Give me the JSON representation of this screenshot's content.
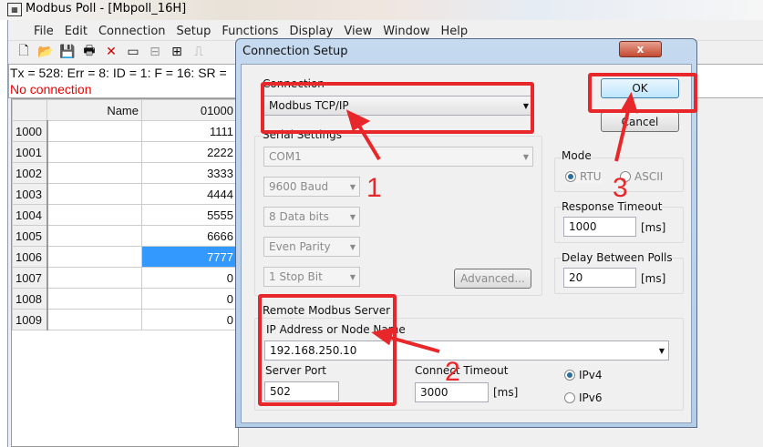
{
  "app": {
    "title": "Modbus Poll - [Mbpoll_16H]",
    "icon": "modbus-app-icon"
  },
  "menu": [
    "File",
    "Edit",
    "Connection",
    "Setup",
    "Functions",
    "Display",
    "View",
    "Window",
    "Help"
  ],
  "toolbar": [
    {
      "icon": "new-icon",
      "glyph": "🗋"
    },
    {
      "icon": "open-icon",
      "glyph": "📂"
    },
    {
      "icon": "save-icon",
      "glyph": "💾"
    },
    {
      "icon": "print-icon",
      "glyph": "🖶"
    },
    {
      "icon": "delete-icon",
      "glyph": "✕"
    },
    {
      "icon": "window-icon",
      "glyph": "▭"
    },
    {
      "icon": "poll-icon",
      "glyph": "⊟"
    },
    {
      "icon": "device-icon",
      "glyph": "⊞"
    },
    {
      "icon": "pulse-icon",
      "glyph": "⎍"
    }
  ],
  "status": {
    "line": "Tx = 528: Err = 8: ID = 1: F = 16: SR =",
    "connection": "No connection"
  },
  "grid": {
    "headers": [
      "",
      "Name",
      "01000"
    ],
    "rows": [
      [
        "1000",
        "",
        "1111"
      ],
      [
        "1001",
        "",
        "2222"
      ],
      [
        "1002",
        "",
        "3333"
      ],
      [
        "1003",
        "",
        "4444"
      ],
      [
        "1004",
        "",
        "5555"
      ],
      [
        "1005",
        "",
        "6666"
      ],
      [
        "1006",
        "",
        "7777"
      ],
      [
        "1007",
        "",
        "0"
      ],
      [
        "1008",
        "",
        "0"
      ],
      [
        "1009",
        "",
        "0"
      ]
    ],
    "selected_row": "1006"
  },
  "dialog": {
    "title": "Connection Setup",
    "close": "x",
    "connection_label": "Connection",
    "connection_value": "Modbus TCP/IP",
    "serial_label": "Serial Settings",
    "port": "COM1",
    "baud": "9600 Baud",
    "data_bits": "8 Data bits",
    "parity": "Even Parity",
    "stop_bits": "1 Stop Bit",
    "advanced": "Advanced...",
    "ok": "OK",
    "cancel": "Cancel",
    "mode_label": "Mode",
    "rtu": "RTU",
    "ascii": "ASCII",
    "response_timeout_label": "Response Timeout",
    "response_timeout": "1000",
    "ms": "[ms]",
    "delay_label": "Delay Between Polls",
    "delay": "20",
    "remote_label": "Remote Modbus Server",
    "ip_label": "IP Address or Node Name",
    "ip": "192.168.250.10",
    "port_label": "Server Port",
    "server_port": "502",
    "connect_timeout_label": "Connect Timeout",
    "connect_timeout": "3000",
    "ipv4": "IPv4",
    "ipv6": "IPv6"
  },
  "annotations": {
    "step1": "1",
    "step2": "2",
    "step3": "3",
    "color": "#e8272a"
  }
}
